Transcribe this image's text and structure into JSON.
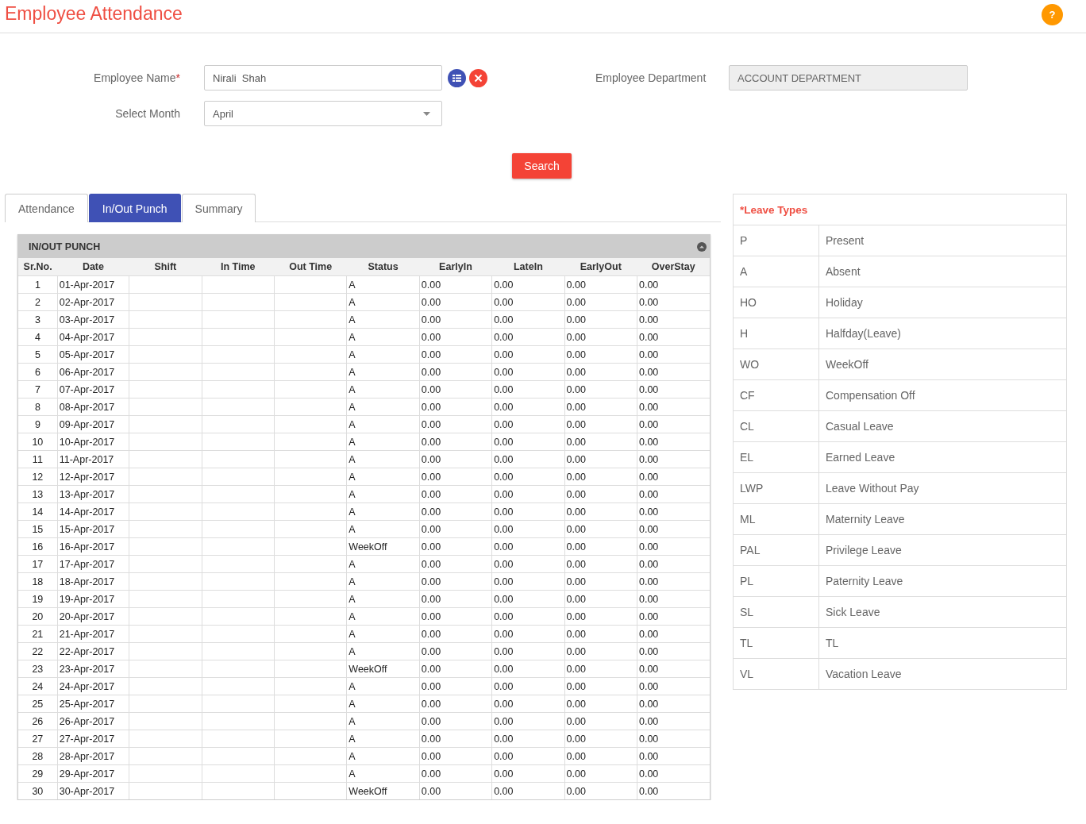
{
  "page_title": "Employee Attendance",
  "help_button": "?",
  "form": {
    "employee_name": {
      "label": "Employee Name",
      "required_mark": "*",
      "value": "Nirali  Shah"
    },
    "month": {
      "label": "Select Month",
      "value": "April"
    },
    "department": {
      "label": "Employee Department",
      "value": "ACCOUNT DEPARTMENT"
    },
    "search_button": "Search"
  },
  "tabs": [
    {
      "label": "Attendance",
      "selected": false
    },
    {
      "label": "In/Out Punch",
      "selected": true
    },
    {
      "label": "Summary",
      "selected": false
    }
  ],
  "punch_panel": {
    "title": "IN/OUT PUNCH",
    "columns": [
      "Sr.No.",
      "Date",
      "Shift",
      "In Time",
      "Out Time",
      "Status",
      "EarlyIn",
      "LateIn",
      "EarlyOut",
      "OverStay"
    ],
    "rows": [
      {
        "sr": "1",
        "date": "01-Apr-2017",
        "status": "A",
        "early_in": "0.00",
        "late_in": "0.00",
        "early_out": "0.00",
        "over_stay": "0.00"
      },
      {
        "sr": "2",
        "date": "02-Apr-2017",
        "status": "A",
        "early_in": "0.00",
        "late_in": "0.00",
        "early_out": "0.00",
        "over_stay": "0.00"
      },
      {
        "sr": "3",
        "date": "03-Apr-2017",
        "status": "A",
        "early_in": "0.00",
        "late_in": "0.00",
        "early_out": "0.00",
        "over_stay": "0.00"
      },
      {
        "sr": "4",
        "date": "04-Apr-2017",
        "status": "A",
        "early_in": "0.00",
        "late_in": "0.00",
        "early_out": "0.00",
        "over_stay": "0.00"
      },
      {
        "sr": "5",
        "date": "05-Apr-2017",
        "status": "A",
        "early_in": "0.00",
        "late_in": "0.00",
        "early_out": "0.00",
        "over_stay": "0.00"
      },
      {
        "sr": "6",
        "date": "06-Apr-2017",
        "status": "A",
        "early_in": "0.00",
        "late_in": "0.00",
        "early_out": "0.00",
        "over_stay": "0.00"
      },
      {
        "sr": "7",
        "date": "07-Apr-2017",
        "status": "A",
        "early_in": "0.00",
        "late_in": "0.00",
        "early_out": "0.00",
        "over_stay": "0.00"
      },
      {
        "sr": "8",
        "date": "08-Apr-2017",
        "status": "A",
        "early_in": "0.00",
        "late_in": "0.00",
        "early_out": "0.00",
        "over_stay": "0.00"
      },
      {
        "sr": "9",
        "date": "09-Apr-2017",
        "status": "A",
        "early_in": "0.00",
        "late_in": "0.00",
        "early_out": "0.00",
        "over_stay": "0.00"
      },
      {
        "sr": "10",
        "date": "10-Apr-2017",
        "status": "A",
        "early_in": "0.00",
        "late_in": "0.00",
        "early_out": "0.00",
        "over_stay": "0.00"
      },
      {
        "sr": "11",
        "date": "11-Apr-2017",
        "status": "A",
        "early_in": "0.00",
        "late_in": "0.00",
        "early_out": "0.00",
        "over_stay": "0.00"
      },
      {
        "sr": "12",
        "date": "12-Apr-2017",
        "status": "A",
        "early_in": "0.00",
        "late_in": "0.00",
        "early_out": "0.00",
        "over_stay": "0.00"
      },
      {
        "sr": "13",
        "date": "13-Apr-2017",
        "status": "A",
        "early_in": "0.00",
        "late_in": "0.00",
        "early_out": "0.00",
        "over_stay": "0.00"
      },
      {
        "sr": "14",
        "date": "14-Apr-2017",
        "status": "A",
        "early_in": "0.00",
        "late_in": "0.00",
        "early_out": "0.00",
        "over_stay": "0.00"
      },
      {
        "sr": "15",
        "date": "15-Apr-2017",
        "status": "A",
        "early_in": "0.00",
        "late_in": "0.00",
        "early_out": "0.00",
        "over_stay": "0.00"
      },
      {
        "sr": "16",
        "date": "16-Apr-2017",
        "status": "WeekOff",
        "early_in": "0.00",
        "late_in": "0.00",
        "early_out": "0.00",
        "over_stay": "0.00"
      },
      {
        "sr": "17",
        "date": "17-Apr-2017",
        "status": "A",
        "early_in": "0.00",
        "late_in": "0.00",
        "early_out": "0.00",
        "over_stay": "0.00"
      },
      {
        "sr": "18",
        "date": "18-Apr-2017",
        "status": "A",
        "early_in": "0.00",
        "late_in": "0.00",
        "early_out": "0.00",
        "over_stay": "0.00"
      },
      {
        "sr": "19",
        "date": "19-Apr-2017",
        "status": "A",
        "early_in": "0.00",
        "late_in": "0.00",
        "early_out": "0.00",
        "over_stay": "0.00"
      },
      {
        "sr": "20",
        "date": "20-Apr-2017",
        "status": "A",
        "early_in": "0.00",
        "late_in": "0.00",
        "early_out": "0.00",
        "over_stay": "0.00"
      },
      {
        "sr": "21",
        "date": "21-Apr-2017",
        "status": "A",
        "early_in": "0.00",
        "late_in": "0.00",
        "early_out": "0.00",
        "over_stay": "0.00"
      },
      {
        "sr": "22",
        "date": "22-Apr-2017",
        "status": "A",
        "early_in": "0.00",
        "late_in": "0.00",
        "early_out": "0.00",
        "over_stay": "0.00"
      },
      {
        "sr": "23",
        "date": "23-Apr-2017",
        "status": "WeekOff",
        "early_in": "0.00",
        "late_in": "0.00",
        "early_out": "0.00",
        "over_stay": "0.00"
      },
      {
        "sr": "24",
        "date": "24-Apr-2017",
        "status": "A",
        "early_in": "0.00",
        "late_in": "0.00",
        "early_out": "0.00",
        "over_stay": "0.00"
      },
      {
        "sr": "25",
        "date": "25-Apr-2017",
        "status": "A",
        "early_in": "0.00",
        "late_in": "0.00",
        "early_out": "0.00",
        "over_stay": "0.00"
      },
      {
        "sr": "26",
        "date": "26-Apr-2017",
        "status": "A",
        "early_in": "0.00",
        "late_in": "0.00",
        "early_out": "0.00",
        "over_stay": "0.00"
      },
      {
        "sr": "27",
        "date": "27-Apr-2017",
        "status": "A",
        "early_in": "0.00",
        "late_in": "0.00",
        "early_out": "0.00",
        "over_stay": "0.00"
      },
      {
        "sr": "28",
        "date": "28-Apr-2017",
        "status": "A",
        "early_in": "0.00",
        "late_in": "0.00",
        "early_out": "0.00",
        "over_stay": "0.00"
      },
      {
        "sr": "29",
        "date": "29-Apr-2017",
        "status": "A",
        "early_in": "0.00",
        "late_in": "0.00",
        "early_out": "0.00",
        "over_stay": "0.00"
      },
      {
        "sr": "30",
        "date": "30-Apr-2017",
        "status": "WeekOff",
        "early_in": "0.00",
        "late_in": "0.00",
        "early_out": "0.00",
        "over_stay": "0.00"
      }
    ]
  },
  "leave_types": {
    "title": "*Leave Types",
    "items": [
      {
        "code": "P",
        "name": "Present"
      },
      {
        "code": "A",
        "name": "Absent"
      },
      {
        "code": "HO",
        "name": "Holiday"
      },
      {
        "code": "H",
        "name": "Halfday(Leave)"
      },
      {
        "code": "WO",
        "name": "WeekOff"
      },
      {
        "code": "CF",
        "name": "Compensation Off"
      },
      {
        "code": "CL",
        "name": "Casual Leave"
      },
      {
        "code": "EL",
        "name": "Earned Leave"
      },
      {
        "code": "LWP",
        "name": "Leave Without Pay"
      },
      {
        "code": "ML",
        "name": "Maternity Leave"
      },
      {
        "code": "PAL",
        "name": "Privilege Leave"
      },
      {
        "code": "PL",
        "name": "Paternity Leave"
      },
      {
        "code": "SL",
        "name": "Sick Leave"
      },
      {
        "code": "TL",
        "name": "TL"
      },
      {
        "code": "VL",
        "name": "Vacation Leave"
      }
    ]
  }
}
